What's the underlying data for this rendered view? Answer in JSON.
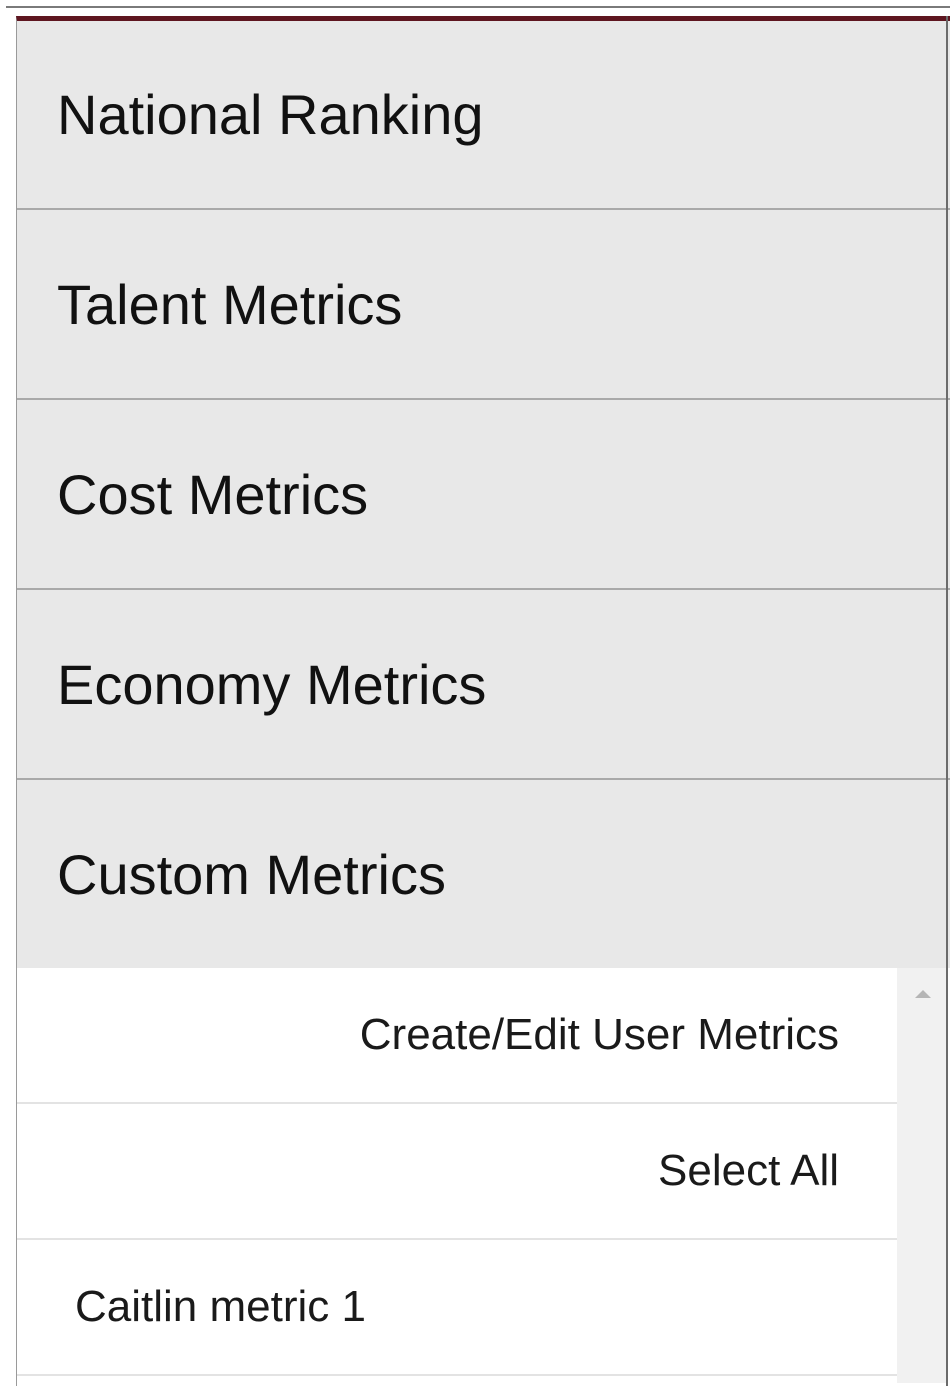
{
  "accordion": {
    "sections": [
      {
        "label": "National Ranking"
      },
      {
        "label": "Talent Metrics"
      },
      {
        "label": "Cost Metrics"
      },
      {
        "label": "Economy Metrics"
      },
      {
        "label": "Custom Metrics"
      }
    ]
  },
  "custom_panel": {
    "create_edit_label": "Create/Edit User Metrics",
    "select_all_label": "Select All",
    "metrics": [
      {
        "label": "Caitlin metric 1"
      }
    ]
  },
  "colors": {
    "accent_border": "#5e1620",
    "header_bg": "#e8e8e8",
    "divider": "#a9a9a9"
  }
}
